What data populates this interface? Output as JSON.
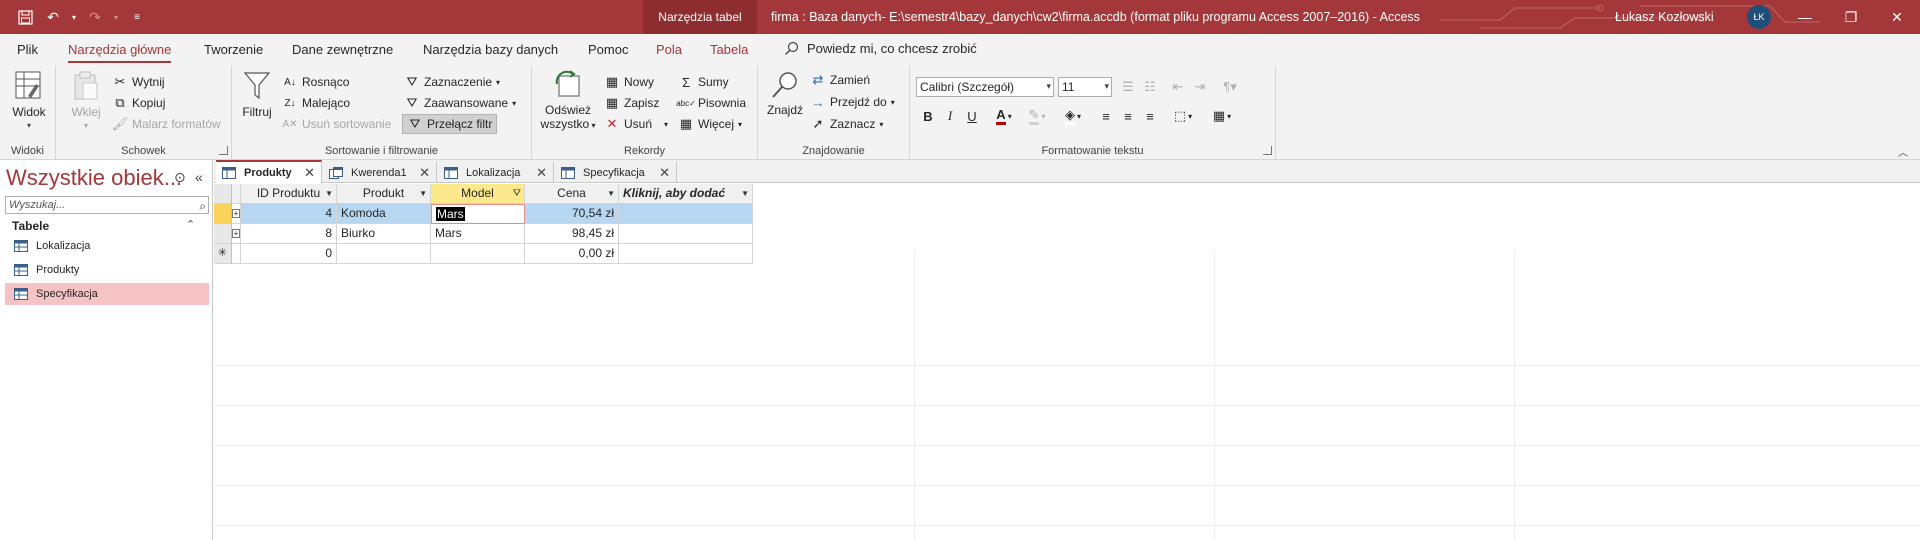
{
  "titlebar": {
    "context_tab": "Narzędzia tabel",
    "window_title": "firma : Baza danych- E:\\semestr4\\bazy_danych\\cw2\\firma.accdb (format pliku programu Access 2007–2016)  -  Access",
    "user_name": "Łukasz Kozłowski",
    "user_initials": "ŁK"
  },
  "menu": {
    "tabs": [
      "Plik",
      "Narzędzia główne",
      "Tworzenie",
      "Dane zewnętrzne",
      "Narzędzia bazy danych",
      "Pomoc",
      "Pola",
      "Tabela"
    ],
    "tell_me": "Powiedz mi, co chcesz zrobić"
  },
  "ribbon": {
    "widoki": {
      "label": "Widoki",
      "view": "Widok"
    },
    "schowek": {
      "label": "Schowek",
      "paste": "Wklej",
      "cut": "Wytnij",
      "copy": "Kopiuj",
      "painter": "Malarz formatów"
    },
    "sort": {
      "label": "Sortowanie i filtrowanie",
      "filter": "Filtruj",
      "asc": "Rosnąco",
      "desc": "Malejąco",
      "remove_sort": "Usuń sortowanie",
      "selection": "Zaznaczenie",
      "advanced": "Zaawansowane",
      "toggle_filter": "Przełącz filtr"
    },
    "records": {
      "label": "Rekordy",
      "refresh_1": "Odśwież",
      "refresh_2": "wszystko",
      "new": "Nowy",
      "save": "Zapisz",
      "delete": "Usuń",
      "totals": "Sumy",
      "spelling": "Pisownia",
      "more": "Więcej"
    },
    "find": {
      "label": "Znajdowanie",
      "find": "Znajdź",
      "replace": "Zamień",
      "goto": "Przejdź do",
      "select": "Zaznacz"
    },
    "text": {
      "label": "Formatowanie tekstu",
      "font": "Calibri (Szczegół)",
      "size": "11",
      "bold": "B",
      "italic": "I",
      "underline": "U"
    }
  },
  "nav": {
    "title": "Wszystkie obiek...",
    "search_placeholder": "Wyszukaj...",
    "group": "Tabele",
    "items": [
      "Lokalizacja",
      "Produkty",
      "Specyfikacja"
    ]
  },
  "doc_tabs": [
    "Produkty",
    "Kwerenda1",
    "Lokalizacja",
    "Specyfikacja"
  ],
  "grid": {
    "headers": [
      "ID Produktu",
      "Produkt",
      "Model",
      "Cena",
      "Kliknij, aby dodać"
    ],
    "rows": [
      {
        "id": "4",
        "produkt": "Komoda",
        "model": "Mars",
        "cena": "70,54 zł"
      },
      {
        "id": "8",
        "produkt": "Biurko",
        "model": "Mars",
        "cena": "98,45 zł"
      }
    ],
    "new_row": {
      "id": "0",
      "cena": "0,00 zł"
    },
    "new_marker": "✳"
  },
  "colors": {
    "accent": "#a4373a",
    "nav_selected": "#f6c3c5",
    "row_selected": "#b7d6f1",
    "filter_header": "#fde98c"
  }
}
